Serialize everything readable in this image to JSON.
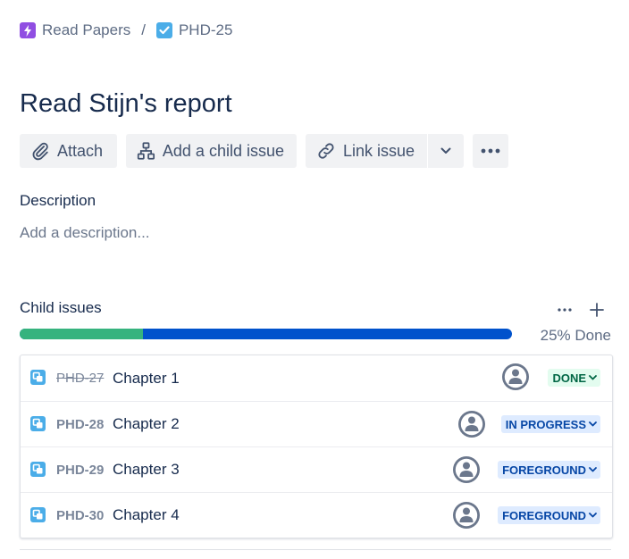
{
  "breadcrumb": {
    "parent_label": "Read Papers",
    "separator": "/",
    "current_label": "PHD-25"
  },
  "issue": {
    "title": "Read Stijn's report"
  },
  "toolbar": {
    "attach_label": "Attach",
    "add_child_label": "Add a child issue",
    "link_label": "Link issue"
  },
  "description": {
    "label": "Description",
    "placeholder": "Add a description..."
  },
  "child_issues": {
    "label": "Child issues",
    "progress_done_fraction": 0.25,
    "progress_text": "25% Done",
    "items": [
      {
        "key": "PHD-27",
        "summary": "Chapter 1",
        "status": "DONE",
        "done": true
      },
      {
        "key": "PHD-28",
        "summary": "Chapter 2",
        "status": "IN PROGRESS",
        "done": false
      },
      {
        "key": "PHD-29",
        "summary": "Chapter 3",
        "status": "FOREGROUND",
        "done": false
      },
      {
        "key": "PHD-30",
        "summary": "Chapter 4",
        "status": "FOREGROUND",
        "done": false
      }
    ]
  },
  "colors": {
    "progress_done": "#36b37e",
    "progress_remaining": "#0052cc",
    "epic_icon": "#904ee2",
    "task_icon": "#4bade8",
    "subtask_icon": "#4bade8"
  },
  "icons": {
    "epic": "lightning-icon",
    "task": "checkbox-icon",
    "attach": "paperclip-icon",
    "add_child": "hierarchy-icon",
    "link": "link-icon",
    "more": "more-icon",
    "add": "plus-icon",
    "subtask": "subtask-icon",
    "avatar": "user-avatar-icon"
  }
}
